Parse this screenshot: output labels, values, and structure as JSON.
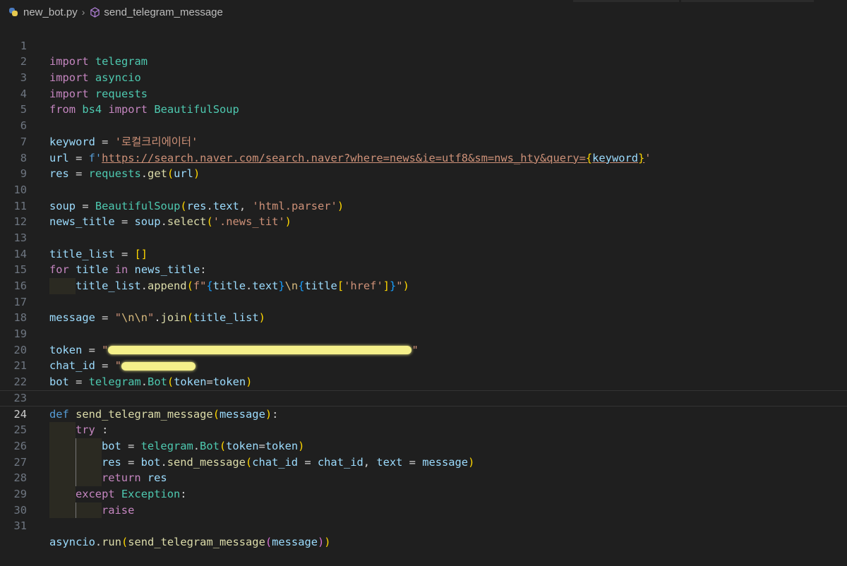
{
  "breadcrumb": {
    "file": "new_bot.py",
    "separator": "›",
    "symbol": "send_telegram_message",
    "file_icon": "python-file-icon",
    "symbol_icon": "method-cube-icon"
  },
  "colors": {
    "background": "#1f1f1f",
    "keyword": "#c586c0",
    "module": "#4ec9b0",
    "function": "#dcdcaa",
    "string": "#ce9178",
    "variable": "#9cdcfe",
    "redaction": "#f5f08a"
  },
  "editor": {
    "current_line": "24",
    "lines": [
      {
        "n": "1",
        "t": {
          "a": "import",
          "b": " ",
          "c": "telegram"
        }
      },
      {
        "n": "2",
        "t": {
          "a": "import",
          "b": " ",
          "c": "asyncio"
        }
      },
      {
        "n": "3",
        "t": {
          "a": "import",
          "b": " ",
          "c": "requests"
        }
      },
      {
        "n": "4",
        "t": {
          "a": "from",
          "b": " ",
          "c": "bs4",
          "d": " ",
          "e": "import",
          "f": " ",
          "g": "BeautifulSoup"
        }
      },
      {
        "n": "5",
        "t": {}
      },
      {
        "n": "6",
        "t": {
          "a": "keyword",
          "b": " = ",
          "c": "'로컬크리에이터'"
        }
      },
      {
        "n": "7",
        "t": {
          "a": "url",
          "b": " = ",
          "c": "f'",
          "d": "https://search.naver.com/search.naver?where=news&ie=utf8&sm=nws_hty&query=",
          "e": "{",
          "f": "keyword",
          "g": "}",
          "h": "'"
        }
      },
      {
        "n": "8",
        "t": {
          "a": "res",
          "b": " = ",
          "c": "requests",
          "d": ".",
          "e": "get",
          "f": "(",
          "g": "url",
          "h": ")"
        }
      },
      {
        "n": "9",
        "t": {}
      },
      {
        "n": "10",
        "t": {
          "a": "soup",
          "b": " = ",
          "c": "BeautifulSoup",
          "d": "(",
          "e": "res",
          "f": ".",
          "g": "text",
          "h": ", ",
          "i": "'html.parser'",
          "j": ")"
        }
      },
      {
        "n": "11",
        "t": {
          "a": "news_title",
          "b": " = ",
          "c": "soup",
          "d": ".",
          "e": "select",
          "f": "(",
          "g": "'.news_tit'",
          "h": ")"
        }
      },
      {
        "n": "12",
        "t": {}
      },
      {
        "n": "13",
        "t": {
          "a": "title_list",
          "b": " = ",
          "c": "[]"
        }
      },
      {
        "n": "14",
        "t": {
          "a": "for",
          "b": " ",
          "c": "title",
          "d": " ",
          "e": "in",
          "f": " ",
          "g": "news_title",
          "h": ":"
        }
      },
      {
        "n": "15",
        "t": {
          "a": "title_list",
          "b": ".",
          "c": "append",
          "d": "(",
          "e": "f\"",
          "f": "{",
          "g": "title",
          "h": ".",
          "i": "text",
          "j": "}",
          "k": "\\n",
          "l": "{",
          "m": "title",
          "n": "[",
          "o": "'href'",
          "p": "]",
          "q": "}",
          "r": "\"",
          "s": ")"
        }
      },
      {
        "n": "16",
        "t": {}
      },
      {
        "n": "17",
        "t": {
          "a": "message",
          "b": " = ",
          "c": "\"",
          "d": "\\n\\n",
          "e": "\"",
          "f": ".",
          "g": "join",
          "h": "(",
          "i": "title_list",
          "j": ")"
        }
      },
      {
        "n": "18",
        "t": {}
      },
      {
        "n": "19",
        "t": {
          "a": "token",
          "b": " = ",
          "c": "\"",
          "e": "\""
        }
      },
      {
        "n": "20",
        "t": {
          "a": "chat_id",
          "b": " = ",
          "c": "\""
        }
      },
      {
        "n": "21",
        "t": {
          "a": "bot",
          "b": " = ",
          "c": "telegram",
          "d": ".",
          "e": "Bot",
          "f": "(",
          "g": "token",
          "h": "=",
          "i": "token",
          "j": ")"
        }
      },
      {
        "n": "22",
        "t": {}
      },
      {
        "n": "23",
        "t": {
          "a": "def",
          "b": " ",
          "c": "send_telegram_message",
          "d": "(",
          "e": "message",
          "f": ")",
          "g": ":"
        }
      },
      {
        "n": "24",
        "t": {
          "a": "try",
          "b": " :"
        }
      },
      {
        "n": "25",
        "t": {
          "a": "bot",
          "b": " = ",
          "c": "telegram",
          "d": ".",
          "e": "Bot",
          "f": "(",
          "g": "token",
          "h": "=",
          "i": "token",
          "j": ")"
        }
      },
      {
        "n": "26",
        "t": {
          "a": "res",
          "b": " = ",
          "c": "bot",
          "d": ".",
          "e": "send_message",
          "f": "(",
          "g": "chat_id",
          "h": " = ",
          "i": "chat_id",
          "j": ", ",
          "k": "text",
          "l": " = ",
          "m": "message",
          "n": ")"
        }
      },
      {
        "n": "27",
        "t": {
          "a": "return",
          "b": " ",
          "c": "res"
        }
      },
      {
        "n": "28",
        "t": {
          "a": "except",
          "b": " ",
          "c": "Exception",
          "d": ":"
        }
      },
      {
        "n": "29",
        "t": {
          "a": "raise"
        }
      },
      {
        "n": "30",
        "t": {}
      },
      {
        "n": "31",
        "t": {
          "a": "asyncio",
          "b": ".",
          "c": "run",
          "d": "(",
          "e": "send_telegram_message",
          "f": "(",
          "g": "message",
          "h": ")",
          "i": ")"
        }
      }
    ]
  }
}
